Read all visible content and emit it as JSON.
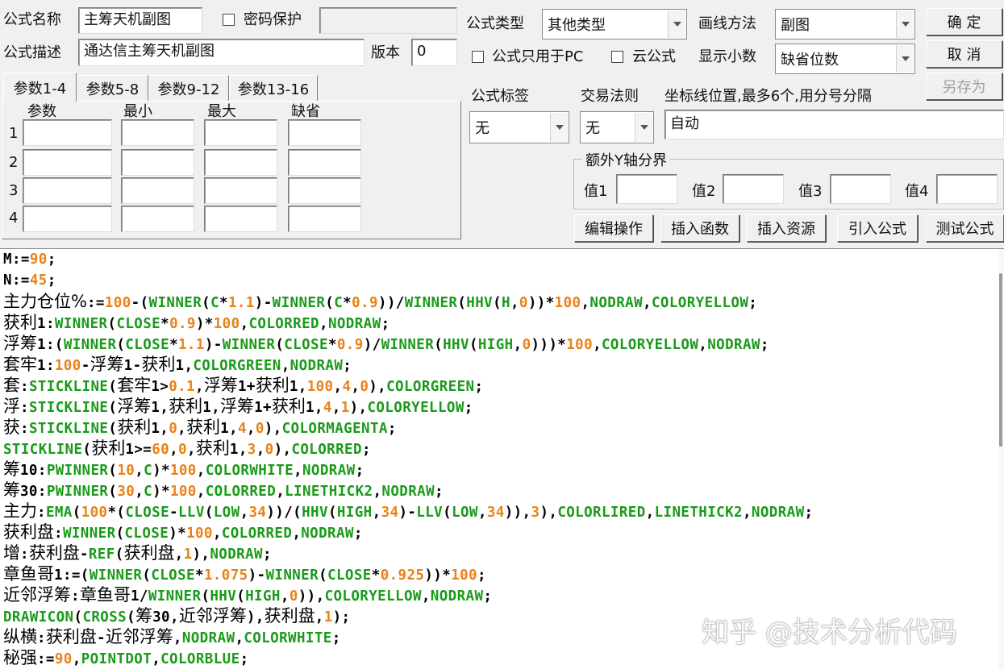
{
  "form": {
    "name_label": "公式名称",
    "name_value": "主筹天机副图",
    "password_label": "密码保护",
    "password_value": "",
    "desc_label": "公式描述",
    "desc_value": "通达信主筹天机副图",
    "version_label": "版本",
    "version_value": "0",
    "type_label": "公式类型",
    "type_value": "其他类型",
    "draw_label": "画线方法",
    "draw_value": "副图",
    "pc_only_label": "公式只用于PC",
    "cloud_label": "云公式",
    "decimals_label": "显示小数",
    "decimals_value": "缺省位数",
    "tag_label": "公式标签",
    "tag_value": "无",
    "trade_rule_label": "交易法则",
    "trade_rule_value": "无",
    "axis_label": "坐标线位置,最多6个,用分号分隔",
    "axis_value": "自动"
  },
  "buttons": {
    "ok": "确  定",
    "cancel": "取  消",
    "save_as": "另存为",
    "edit_ops": "编辑操作",
    "insert_func": "插入函数",
    "insert_res": "插入资源",
    "import_formula": "引入公式",
    "test_formula": "测试公式"
  },
  "tabs": [
    "参数1-4",
    "参数5-8",
    "参数9-12",
    "参数13-16"
  ],
  "params": {
    "headers": [
      "参数",
      "最小",
      "最大",
      "缺省"
    ],
    "rows": [
      "1",
      "2",
      "3",
      "4"
    ]
  },
  "yaxis": {
    "title": "额外Y轴分界",
    "labels": [
      "值1",
      "值2",
      "值3",
      "值4"
    ]
  },
  "code_lines": [
    "M:=90;",
    "N:=45;",
    "主力仓位%:=100-(WINNER(C*1.1)-WINNER(C*0.9))/WINNER(HHV(H,0))*100,NODRAW,COLORYELLOW;",
    "获利1:WINNER(CLOSE*0.9)*100,COLORRED,NODRAW;",
    "浮筹1:(WINNER(CLOSE*1.1)-WINNER(CLOSE*0.9)/WINNER(HHV(HIGH,0)))*100,COLORYELLOW,NODRAW;",
    "套牢1:100-浮筹1-获利1,COLORGREEN,NODRAW;",
    "套:STICKLINE(套牢1>0.1,浮筹1+获利1,100,4,0),COLORGREEN;",
    "浮:STICKLINE(浮筹1,获利1,浮筹1+获利1,4,1),COLORYELLOW;",
    "获:STICKLINE(获利1,0,获利1,4,0),COLORMAGENTA;",
    "STICKLINE(获利1>=60,0,获利1,3,0),COLORRED;",
    "筹10:PWINNER(10,C)*100,COLORWHITE,NODRAW;",
    "筹30:PWINNER(30,C)*100,COLORRED,LINETHICK2,NODRAW;",
    "主力:EMA(100*(CLOSE-LLV(LOW,34))/(HHV(HIGH,34)-LLV(LOW,34)),3),COLORLIRED,LINETHICK2,NODRAW;",
    "获利盘:WINNER(CLOSE)*100,COLORRED,NODRAW;",
    "增:获利盘-REF(获利盘,1),NODRAW;",
    "章鱼哥1:=(WINNER(CLOSE*1.075)-WINNER(CLOSE*0.925))*100;",
    "近邻浮筹:章鱼哥1/WINNER(HHV(HIGH,0)),COLORYELLOW,NODRAW;",
    "DRAWICON(CROSS(筹30,近邻浮筹),获利盘,1);",
    "纵横:获利盘-近邻浮筹,NODRAW,COLORWHITE;",
    "秘强:=90,POINTDOT,COLORBLUE;"
  ],
  "watermark": "知乎 @技术分析代码",
  "colors": {
    "function": "#1a9a1a",
    "number": "#e8821a",
    "text": "#000000",
    "background": "#f0f0f0"
  }
}
